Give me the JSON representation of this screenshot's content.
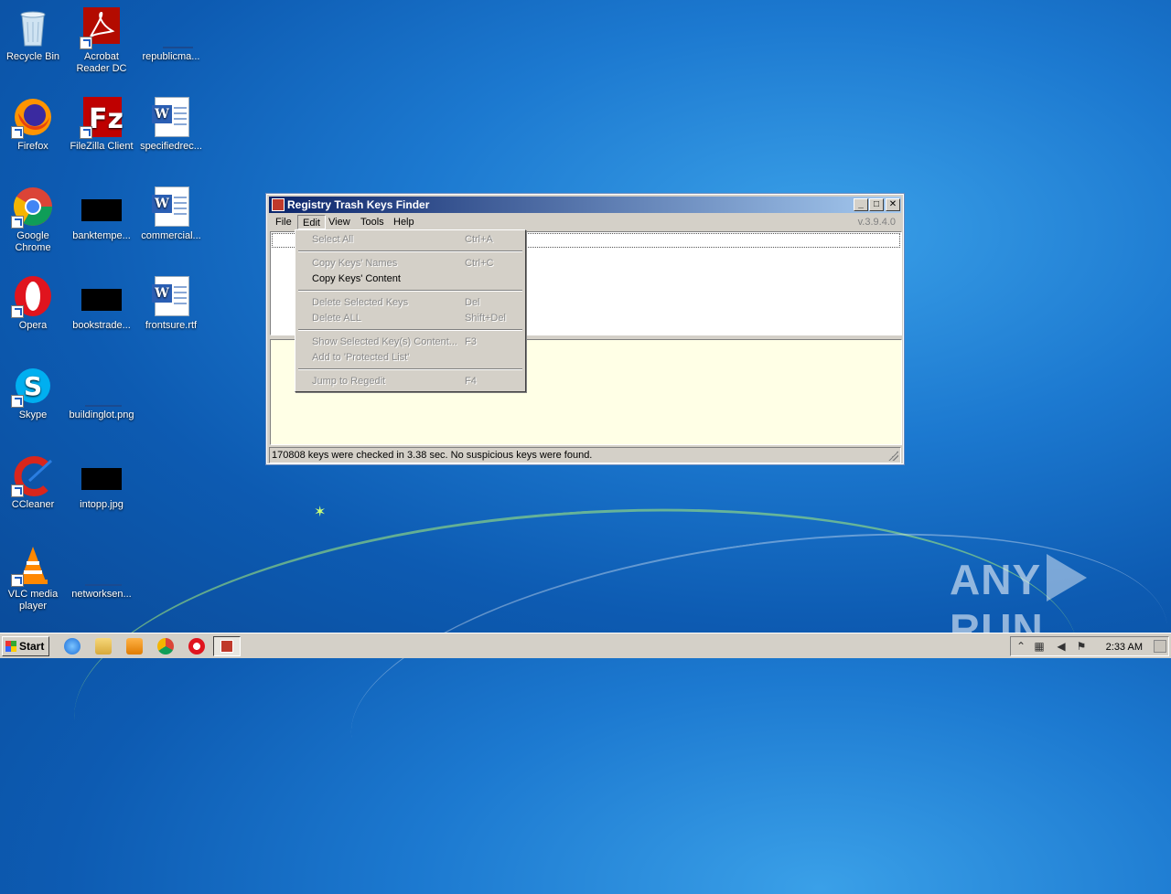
{
  "desktop": {
    "icons": [
      {
        "label": "Recycle Bin",
        "icon": "recycle-bin-icon"
      },
      {
        "label": "Acrobat Reader DC",
        "icon": "acrobat-icon"
      },
      {
        "label": "republicma...",
        "icon": "file-icon"
      },
      {
        "label": "Firefox",
        "icon": "firefox-icon"
      },
      {
        "label": "FileZilla Client",
        "icon": "filezilla-icon"
      },
      {
        "label": "specifiedrec...",
        "icon": "word-doc-icon"
      },
      {
        "label": "Google Chrome",
        "icon": "chrome-icon"
      },
      {
        "label": "banktempe...",
        "icon": "image-file-icon"
      },
      {
        "label": "commercial...",
        "icon": "word-doc-icon"
      },
      {
        "label": "Opera",
        "icon": "opera-icon"
      },
      {
        "label": "bookstrade...",
        "icon": "image-file-icon"
      },
      {
        "label": "frontsure.rtf",
        "icon": "word-doc-icon"
      },
      {
        "label": "Skype",
        "icon": "skype-icon"
      },
      {
        "label": "buildinglot.png",
        "icon": "image-file-icon"
      },
      {
        "label": "CCleaner",
        "icon": "ccleaner-icon"
      },
      {
        "label": "intopp.jpg",
        "icon": "image-file-icon"
      },
      {
        "label": "VLC media player",
        "icon": "vlc-icon"
      },
      {
        "label": "networksen...",
        "icon": "file-icon"
      }
    ]
  },
  "window": {
    "title": "Registry Trash Keys Finder",
    "version": "v.3.9.4.0",
    "menu": [
      "File",
      "Edit",
      "View",
      "Tools",
      "Help"
    ],
    "status": "170808 keys were checked in 3.38 sec. No suspicious keys were found."
  },
  "edit_menu": [
    {
      "label": "Select All",
      "shortcut": "Ctrl+A",
      "enabled": false
    },
    {
      "label": "Copy Keys' Names",
      "shortcut": "Ctrl+C",
      "enabled": false
    },
    {
      "label": "Copy Keys' Content",
      "shortcut": "",
      "enabled": true
    },
    {
      "label": "Delete Selected Keys",
      "shortcut": "Del",
      "enabled": false
    },
    {
      "label": "Delete ALL",
      "shortcut": "Shift+Del",
      "enabled": false
    },
    {
      "label": "Show Selected Key(s) Content...",
      "shortcut": "F3",
      "enabled": false
    },
    {
      "label": "Add to 'Protected List'",
      "shortcut": "",
      "enabled": false
    },
    {
      "label": "Jump to Regedit",
      "shortcut": "F4",
      "enabled": false
    }
  ],
  "taskbar": {
    "start_label": "Start",
    "clock": "2:33 AM"
  },
  "watermark": {
    "left": "ANY",
    "right": "RUN"
  }
}
